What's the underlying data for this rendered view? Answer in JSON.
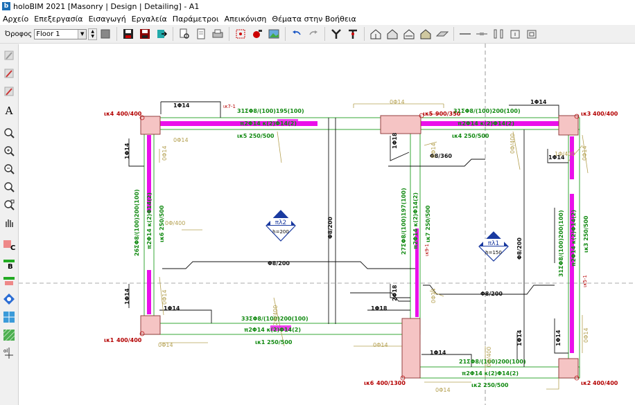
{
  "window": {
    "title": "holoBIM 2021 [Masonry | Design | Detailing] - A1",
    "app_icon": "b"
  },
  "menu": [
    "Αρχείο",
    "Επεξεργασία",
    "Εισαγωγή",
    "Εργαλεία",
    "Παράμετροι",
    "Απεικόνιση",
    "Θέματα στην Βοήθεια"
  ],
  "toolbar": {
    "floor_label": "Όροφος",
    "floor_value": "Floor 1",
    "icons": [
      "stop-icon",
      "save-icon",
      "save-as-icon",
      "export-icon",
      "find-icon",
      "preview-icon",
      "print-icon",
      "select-area-icon",
      "render-icon",
      "image-icon",
      "undo-icon",
      "redo-icon",
      "column-y-icon",
      "column-t-icon",
      "house-wire-icon",
      "house-solid-icon",
      "house-beam-icon",
      "house-shaded-icon",
      "slab-icon",
      "line-tool-icon",
      "dim-line-icon",
      "wall-tool-icon",
      "door-tool-icon",
      "window-tool-icon"
    ]
  },
  "left_tools": [
    "edit-pen-icon",
    "edit-pen2-icon",
    "edit-pen3-icon",
    "text-icon",
    "zoom-realtime-icon",
    "zoom-in-icon",
    "zoom-out-icon",
    "zoom-extents-icon",
    "zoom-window-icon",
    "pan-icon",
    "column-c-icon",
    "beam-b-icon",
    "beam-section-icon",
    "slab-node-icon",
    "grid-icon",
    "hatch-icon",
    "dimension-icon"
  ],
  "drawing": {
    "beams": {
      "k7": {
        "label": "ικ7-1",
        "stirrups": "31ΣΦ8/(100)195(100)"
      },
      "k5": {
        "stirrups": "31ΣΦ8/(100)195(100)",
        "top_bars": "π2Φ14 κ(2)Φ14(2)",
        "section": "ικ5 250/500"
      },
      "k4": {
        "stirrups": "31ΣΦ8/(100)200(100)",
        "top_bars": "π2Φ14 κ(2)Φ14(2)",
        "section": "ικ4 250/500"
      },
      "k1": {
        "stirrups": "33ΣΦ8/(100)200(100)",
        "top_bars": "π2Φ14 κ(2)Φ14(2)",
        "section": "ικ1 250/500"
      },
      "k2": {
        "stirrups": "21ΣΦ8/(100)200(100)",
        "top_bars": "π2Φ14 κ(2)Φ14(2)",
        "section": "ικ2 250/500"
      },
      "k6": {
        "stirrups": "26ΣΦ8/(100)200(100)",
        "top_bars": "π2Φ14 κ(2)Φ14(2)",
        "section": "ικ6 250/500"
      },
      "k9": {
        "stirrups": "27ΣΦ8/(100)197(100)",
        "top_bars": "π2Φ14 κ(2)Φ14(2)",
        "section": "ικ7 250/500",
        "label": "ικ9-1"
      },
      "k3": {
        "stirrups": "31ΣΦ8/(100)200(100)",
        "top_bars": "π2Φ14 κ(2)Φ14(2)",
        "section": "ικ3 250/500",
        "label": "ικ5-1"
      }
    },
    "columns": [
      {
        "id": "ικ4",
        "size": "400/400"
      },
      {
        "id": "ικ5",
        "size": "900/350"
      },
      {
        "id": "ικ3",
        "size": "400/400"
      },
      {
        "id": "ικ1",
        "size": "400/400"
      },
      {
        "id": "ικ6",
        "size": "400/1300"
      },
      {
        "id": "ικ2",
        "size": "400/400"
      }
    ],
    "slabs": [
      {
        "name": "πλ2",
        "thickness": "h=200"
      },
      {
        "name": "πλ1",
        "thickness": "h=150"
      }
    ],
    "rebar_labels": {
      "d14": "0Φ14",
      "b14": "1Φ14",
      "b18": "1Φ18",
      "c18": "2Φ18",
      "mesh200": "Φ8/200",
      "mesh360": "Φ8/360",
      "d400": "0Φ/400",
      "b400": "1Φ/400",
      "c400": "2Φ/400"
    }
  },
  "colors": {
    "beam_text": "#128a12",
    "column_text": "#b40000",
    "section_fill": "#f5c4c4",
    "rebar": "#ea10ea",
    "olive": "#b4a050"
  }
}
